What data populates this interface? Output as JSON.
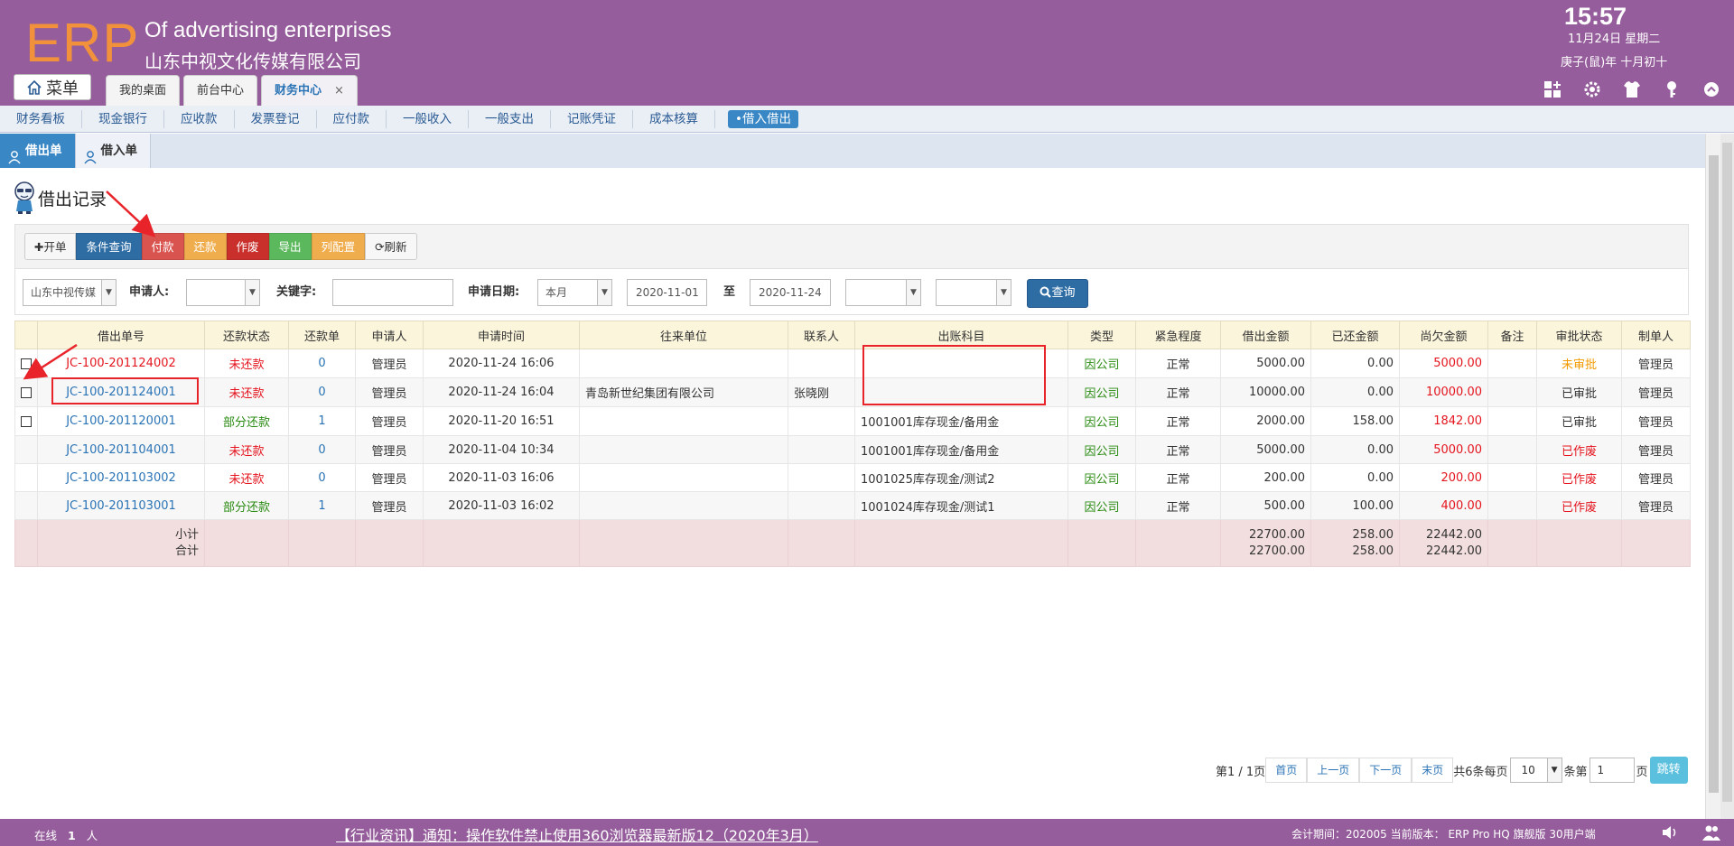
{
  "header": {
    "logo": "ERP",
    "company_en": "Of advertising enterprises",
    "company_cn": "山东中视文化传媒有限公司",
    "time": "15:57",
    "date": "11月24日 星期二",
    "lunar": "庚子(鼠)年 十月初十",
    "menu_label": "菜单",
    "tabs": [
      {
        "label": "我的桌面"
      },
      {
        "label": "前台中心"
      },
      {
        "label": "财务中心",
        "close": "×"
      }
    ]
  },
  "subnav": {
    "items": [
      {
        "label": "财务看板"
      },
      {
        "label": "现金银行"
      },
      {
        "label": "应收款"
      },
      {
        "label": "发票登记"
      },
      {
        "label": "应付款"
      },
      {
        "label": "一般收入"
      },
      {
        "label": "一般支出"
      },
      {
        "label": "记账凭证"
      },
      {
        "label": "成本核算"
      }
    ],
    "active_label": "•借入借出"
  },
  "tabs2": [
    {
      "label": "借出单"
    },
    {
      "label": "借入单"
    }
  ],
  "page_title": "借出记录",
  "toolbar": {
    "open": "✚开单",
    "query": "条件查询",
    "pay": "付款",
    "repay": "还款",
    "void": "作废",
    "export": "导出",
    "columns": "列配置",
    "refresh": "⟳刷新"
  },
  "filters": {
    "company": "山东中视传媒",
    "applicant_label": "申请人:",
    "applicant_value": "",
    "keyword_label": "关键字:",
    "keyword_value": "",
    "date_label": "申请日期:",
    "period": "本月",
    "start_date": "2020-11-01",
    "to": "至",
    "end_date": "2020-11-24",
    "extra1": "",
    "extra2": "",
    "query_btn": "查询"
  },
  "table": {
    "headers": [
      "借出单号",
      "还款状态",
      "还款单",
      "申请人",
      "申请时间",
      "往来单位",
      "联系人",
      "出账科目",
      "类型",
      "紧急程度",
      "借出金额",
      "已还金额",
      "尚欠金额",
      "备注",
      "审批状态",
      "制单人"
    ],
    "rows": [
      {
        "no": "JC-100-201124002",
        "status": "未还款",
        "repay": "0",
        "applicant": "管理员",
        "time": "2020-11-24 16:06",
        "unit": "",
        "contact": "",
        "subject": "",
        "type": "因公司",
        "urgency": "正常",
        "amount": "5000.00",
        "repaid": "0.00",
        "owed": "5000.00",
        "remark": "",
        "approval": "未审批",
        "maker": "管理员"
      },
      {
        "no": "JC-100-201124001",
        "status": "未还款",
        "repay": "0",
        "applicant": "管理员",
        "time": "2020-11-24 16:04",
        "unit": "青岛新世纪集团有限公司",
        "contact": "张晓刚",
        "subject": "",
        "type": "因公司",
        "urgency": "正常",
        "amount": "10000.00",
        "repaid": "0.00",
        "owed": "10000.00",
        "remark": "",
        "approval": "已审批",
        "maker": "管理员"
      },
      {
        "no": "JC-100-201120001",
        "status": "部分还款",
        "repay": "1",
        "applicant": "管理员",
        "time": "2020-11-20 16:51",
        "unit": "",
        "contact": "",
        "subject": "1001001库存现金/备用金",
        "type": "因公司",
        "urgency": "正常",
        "amount": "2000.00",
        "repaid": "158.00",
        "owed": "1842.00",
        "remark": "",
        "approval": "已审批",
        "maker": "管理员"
      },
      {
        "no": "JC-100-201104001",
        "status": "未还款",
        "repay": "0",
        "applicant": "管理员",
        "time": "2020-11-04 10:34",
        "unit": "",
        "contact": "",
        "subject": "1001001库存现金/备用金",
        "type": "因公司",
        "urgency": "正常",
        "amount": "5000.00",
        "repaid": "0.00",
        "owed": "5000.00",
        "remark": "",
        "approval": "已作废",
        "maker": "管理员"
      },
      {
        "no": "JC-100-201103002",
        "status": "未还款",
        "repay": "0",
        "applicant": "管理员",
        "time": "2020-11-03 16:06",
        "unit": "",
        "contact": "",
        "subject": "1001025库存现金/测试2",
        "type": "因公司",
        "urgency": "正常",
        "amount": "200.00",
        "repaid": "0.00",
        "owed": "200.00",
        "remark": "",
        "approval": "已作废",
        "maker": "管理员"
      },
      {
        "no": "JC-100-201103001",
        "status": "部分还款",
        "repay": "1",
        "applicant": "管理员",
        "time": "2020-11-03 16:02",
        "unit": "",
        "contact": "",
        "subject": "1001024库存现金/测试1",
        "type": "因公司",
        "urgency": "正常",
        "amount": "500.00",
        "repaid": "100.00",
        "owed": "400.00",
        "remark": "",
        "approval": "已作废",
        "maker": "管理员"
      }
    ],
    "subtotal_label": "小计",
    "total_label": "合计",
    "subtotal": {
      "amount": "22700.00",
      "repaid": "258.00",
      "owed": "22442.00"
    },
    "total": {
      "amount": "22700.00",
      "repaid": "258.00",
      "owed": "22442.00"
    }
  },
  "pager": {
    "page_info": "第1 / 1页",
    "first": "首页",
    "prev": "上一页",
    "next": "下一页",
    "last": "末页",
    "count_info": "共6条每页",
    "per_page": "10",
    "goto_prefix": "条第",
    "goto_value": "1",
    "goto_suffix": "页",
    "go": "跳转"
  },
  "footer": {
    "online_label": "在线",
    "online_count": "1",
    "online_unit": "人",
    "news": "【行业资讯】通知：操作软件禁止使用360浏览器最新版12（2020年3月）",
    "version": "会计期间：202005 当前版本： ERP Pro HQ 旗舰版 30用户端"
  },
  "colors": {
    "header_bg": "#955d9b",
    "logo": "#f1913c",
    "accent_blue": "#3a87c6",
    "status_red": "#e4151e",
    "status_green": "#2a8b12",
    "annotation": "#e8242a"
  }
}
